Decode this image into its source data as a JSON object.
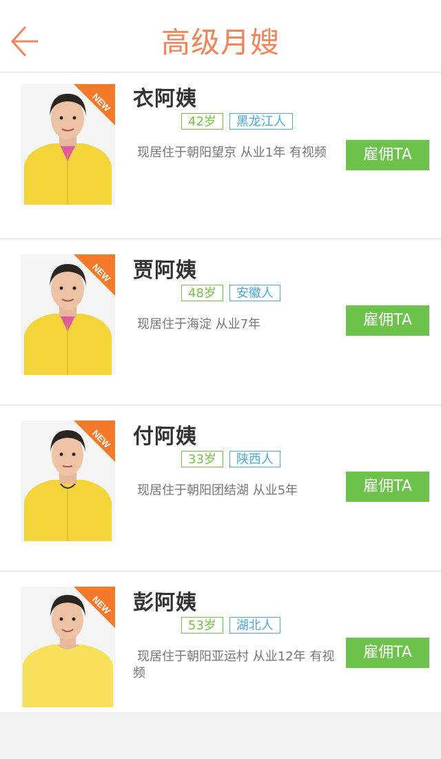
{
  "header": {
    "title": "高级月嫂"
  },
  "badge_text": "NEW",
  "colors": {
    "accent": "#f0845a",
    "hire_button": "#6cc24a",
    "age_tag": "#74bf44",
    "origin_tag": "#4aa8de",
    "uniform": "#f3d43a"
  },
  "nannies": [
    {
      "name": "衣阿姨",
      "age": "42岁",
      "origin": "黑龙江人",
      "description": "现居住于朝阳望京 从业1年 有视频",
      "hire_label": "雇佣TA"
    },
    {
      "name": "贾阿姨",
      "age": "48岁",
      "origin": "安徽人",
      "description": "现居住于海淀 从业7年",
      "hire_label": "雇佣TA"
    },
    {
      "name": "付阿姨",
      "age": "33岁",
      "origin": "陕西人",
      "description": "现居住于朝阳团结湖 从业5年",
      "hire_label": "雇佣TA"
    },
    {
      "name": "彭阿姨",
      "age": "53岁",
      "origin": "湖北人",
      "description": "现居住于朝阳亚运村 从业12年 有视频",
      "hire_label": "雇佣TA"
    }
  ]
}
